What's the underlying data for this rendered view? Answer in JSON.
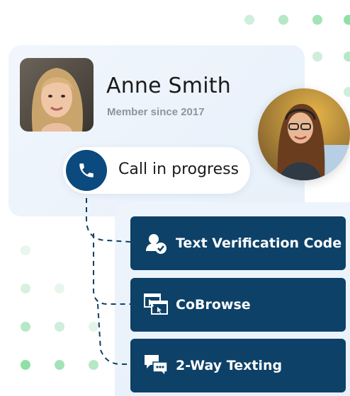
{
  "profile": {
    "name": "Anne Smith",
    "member_since": "Member since 2017"
  },
  "call": {
    "status": "Call in progress",
    "icon": "phone-icon"
  },
  "actions": [
    {
      "label": "Text Verification Code",
      "icon": "verified-user-icon"
    },
    {
      "label": "CoBrowse",
      "icon": "browser-windows-icon"
    },
    {
      "label": "2-Way Texting",
      "icon": "chat-bubbles-icon"
    }
  ],
  "colors": {
    "navy": "#0d4168",
    "call_button": "#0b4a7e",
    "card_bg": "#eef4fb",
    "dot_green": "#8fe0a6",
    "muted_text": "#8a96a3"
  }
}
